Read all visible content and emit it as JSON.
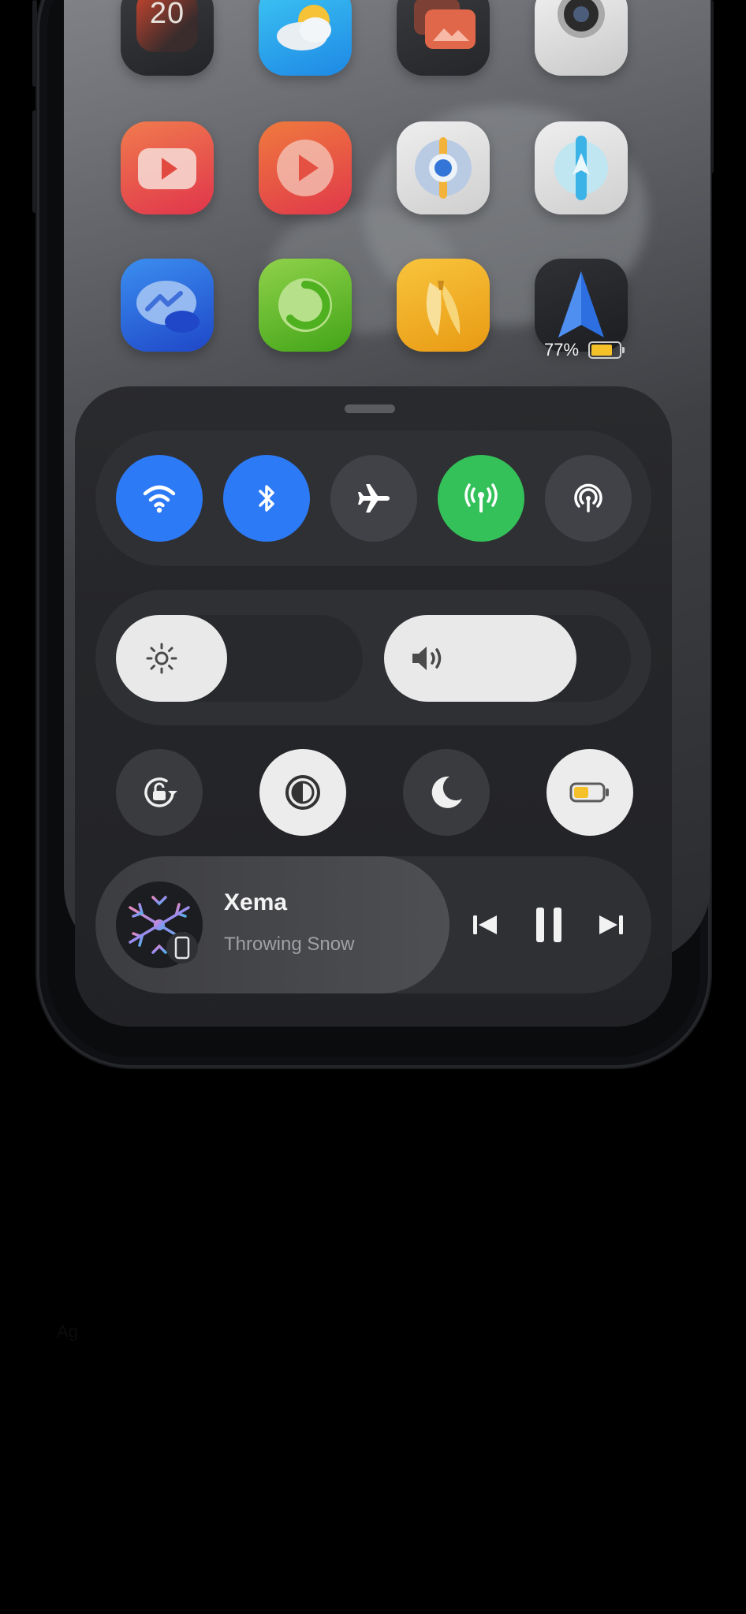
{
  "home_screen": {
    "apps": [
      {
        "name": "Calendar",
        "label": "20"
      },
      {
        "name": "Weather"
      },
      {
        "name": "Photos"
      },
      {
        "name": "Camera"
      },
      {
        "name": "YouTube"
      },
      {
        "name": "Infuse"
      },
      {
        "name": "Find My"
      },
      {
        "name": "Maps"
      },
      {
        "name": "Messenger"
      },
      {
        "name": "Green app"
      },
      {
        "name": "Banana app"
      },
      {
        "name": "Navigation"
      }
    ],
    "battery": {
      "percent_label": "77%",
      "level": 0.77,
      "fill_color": "#f4c12a"
    }
  },
  "control_center": {
    "connectivity": [
      {
        "name": "wifi",
        "state": "on",
        "color": "#2d7af6"
      },
      {
        "name": "bluetooth",
        "state": "on",
        "color": "#2d7af6"
      },
      {
        "name": "airplane-mode",
        "state": "off"
      },
      {
        "name": "cellular-data",
        "state": "on",
        "color": "#34c159"
      },
      {
        "name": "airdrop",
        "state": "off"
      }
    ],
    "brightness": {
      "level": 0.45
    },
    "volume": {
      "level": 0.78
    },
    "quick_toggles": [
      {
        "name": "rotation-lock",
        "state": "off"
      },
      {
        "name": "dark-mode",
        "state": "on"
      },
      {
        "name": "do-not-disturb",
        "state": "off"
      },
      {
        "name": "low-power-mode",
        "state": "on"
      }
    ],
    "now_playing": {
      "title": "Xema",
      "artist": "Throwing Snow"
    }
  },
  "misc": {
    "stray_text": "Ag"
  }
}
